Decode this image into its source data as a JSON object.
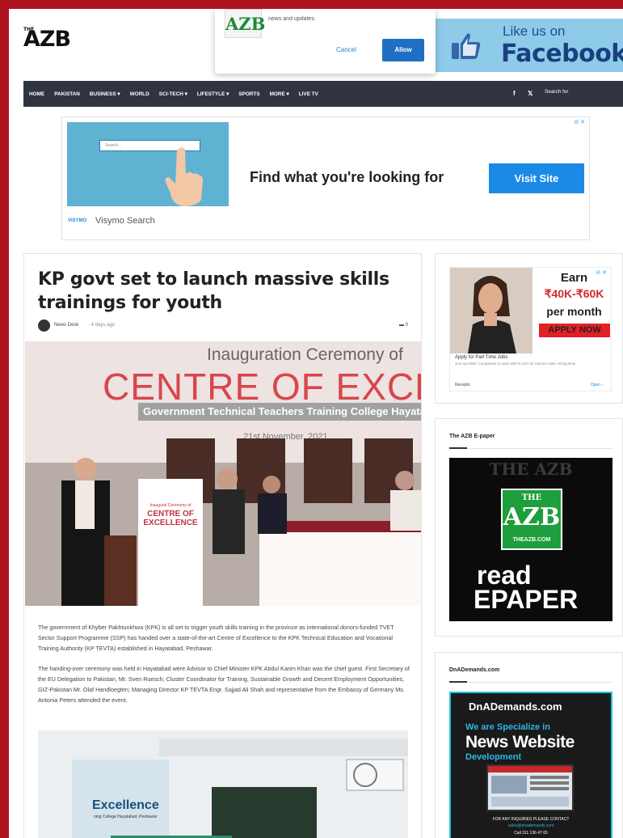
{
  "site": {
    "logo": "AZB",
    "logo_small": "THE"
  },
  "popup": {
    "logo": "AZB",
    "text": "news and updates.",
    "cancel": "Cancel",
    "allow": "Allow"
  },
  "facebook_banner": {
    "like": "Like us on",
    "name": "Facebook"
  },
  "nav": {
    "items": [
      "HOME",
      "PAKISTAN",
      "BUSINESS ▾",
      "WORLD",
      "SCI-TECH ▾",
      "LIFESTYLE ▾",
      "SPORTS",
      "MORE ▾",
      "LIVE TV"
    ],
    "facebook": "f",
    "twitter": "𝕏",
    "search_placeholder": "Search for"
  },
  "ad_top": {
    "search_text": "Search...",
    "headline": "Find what you're looking for",
    "button": "Visit Site",
    "brand_logo": "VISYMO",
    "brand": "Visymo Search",
    "adchoices": "⊘ ✕"
  },
  "article": {
    "title": "KP govt set to launch massive skills trainings for youth",
    "author": "News Desk",
    "date": "·  4 days ago",
    "comments": "▬ 0",
    "hero": {
      "line1": "Inauguration Ceremony of",
      "line2": "CENTRE OF EXCELLENC",
      "line3": "Government Technical Teachers Training College Hayatabad, Peshawar",
      "line4": "21st November, 2021",
      "standee1": "Inaugural Ceremony of",
      "standee2": "CENTRE OF EXCELLENCE"
    },
    "paragraphs": [
      "The government of Khyber Pakhtunkhwa (KPK) is all set to trigger youth skills training in the province as international donors-funded TVET Sector Support Programme (SSP) has handed over a state-of-the-art Centre of Excellence to the KPK Technical Education and Vocational Training Authority (KP TEVTA) established in Hayatabad, Peshawar.",
      "The handing-over ceremony was held in Hayatabad were Advisor to Chief Minister KPK Abdul Karim Khan was the chief guest. First Secretary of the EU Delegation to Pakistan, Mr. Sven Ruesch; Cluster Coordinator for Training, Sustainable Growth and Decent Employment Opportunities, GIZ-Pakistan Mr. Olaf Handloegten; Managing Director KP TEVTA Engr. Sajjad Ali Shah and representative from the Embassy of Germany Ms. Antonia Peters attended the event."
    ],
    "photo2_text": "Excellence",
    "photo2_sub": "ning College Hayatabad, Peshawar"
  },
  "sidebar": {
    "ad": {
      "earn": "Earn",
      "amount": "₹40K-₹60K",
      "per_month": "per month",
      "apply": "APPLY NOW",
      "job_title": "Apply for Part Time Jobs",
      "job_sub": "Join top MNC Companies to work with in USA for various roles. Hiring Now",
      "sponsor": "Recepto",
      "open": "Open  ›",
      "adchoices": "⊘ ✕"
    },
    "epaper": {
      "title": "The AZB E-paper",
      "top_text": "THE AZB",
      "logo_the": "THE",
      "logo_azb": "AZB",
      "logo_url": "THEAZB.COM",
      "read": "read",
      "epaper": "EPAPER"
    },
    "dna": {
      "title": "DnADemands.com",
      "logo": "DnADemands.com",
      "line1": "We are Specialize in",
      "line2": "News Website",
      "line3": "Development",
      "line4": "FOR ANY INQUIRIES PLEASE CONTACT",
      "line5": "sales@dnademands.com",
      "line6": "Call 311 136 47 65"
    }
  }
}
